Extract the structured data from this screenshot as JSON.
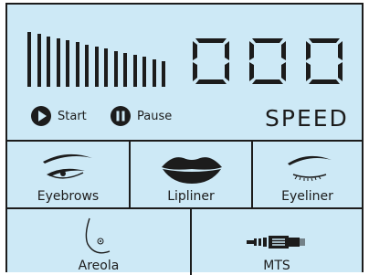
{
  "controls": {
    "start_label": "Start",
    "pause_label": "Pause"
  },
  "speed": {
    "digits": [
      "0",
      "0",
      "0"
    ],
    "label": "SPEED",
    "level_bars": 15
  },
  "modes": [
    {
      "label": "Eyebrows",
      "icon": "eyebrow-icon"
    },
    {
      "label": "Lipliner",
      "icon": "lips-icon"
    },
    {
      "label": "Eyeliner",
      "icon": "eyeliner-icon"
    },
    {
      "label": "Areola",
      "icon": "areola-icon"
    },
    {
      "label": "MTS",
      "icon": "mts-needle-icon"
    }
  ],
  "colors": {
    "panel_bg": "#cde9f6",
    "ink": "#1c1c1c"
  }
}
